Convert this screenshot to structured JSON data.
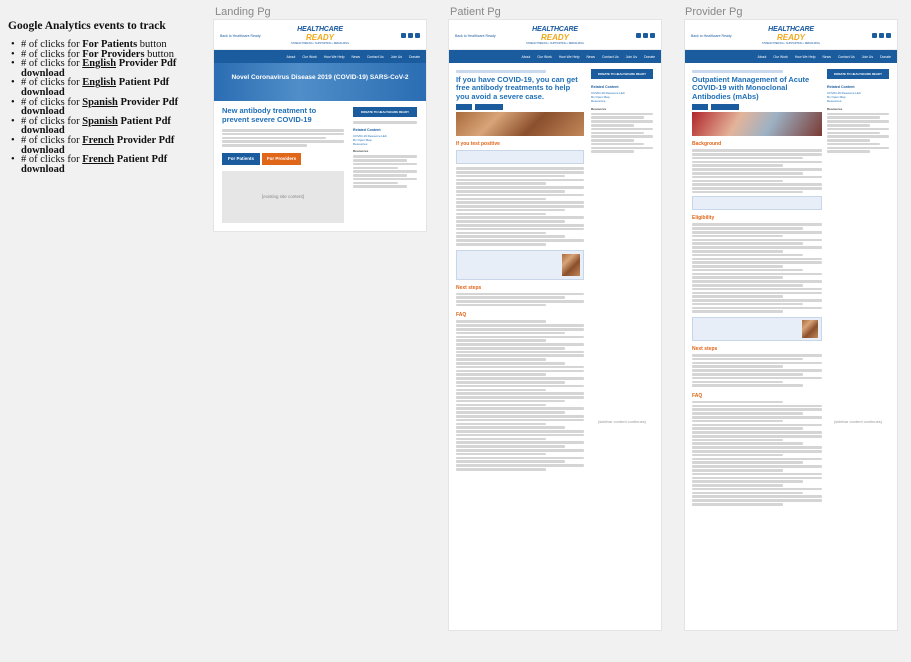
{
  "notes": {
    "title": "Google Analytics events to track",
    "items": [
      {
        "prefix": "# of clicks for ",
        "bold": "For Patients",
        "underline": "",
        "rest": " button"
      },
      {
        "prefix": "# of clicks for ",
        "bold": "For Providers",
        "underline": "",
        "rest": " button"
      },
      {
        "prefix": "# of clicks for ",
        "bold": "",
        "underline": "English",
        "rest": " Provider Pdf download"
      },
      {
        "prefix": "# of clicks for ",
        "bold": "",
        "underline": "English",
        "rest": " Patient Pdf download"
      },
      {
        "prefix": "# of clicks for ",
        "bold": "",
        "underline": "Spanish",
        "rest": " Provider Pdf download"
      },
      {
        "prefix": "# of clicks for ",
        "bold": "",
        "underline": "Spanish",
        "rest": " Patient Pdf download"
      },
      {
        "prefix": "# of clicks for ",
        "bold": "",
        "underline": "French",
        "rest": " Provider Pdf download"
      },
      {
        "prefix": "# of clicks for ",
        "bold": "",
        "underline": "French",
        "rest": " Patient Pdf download"
      }
    ]
  },
  "columns": {
    "landing": "Landing Pg",
    "patient": "Patient Pg",
    "provider": "Provider Pg"
  },
  "site": {
    "back_link": "Back to Healthcare Ready",
    "logo_top": "HEALTHCARE",
    "logo_bottom": "READY",
    "logo_tag": "STRENGTHENING • SUPPORTING • REBUILDING",
    "nav": [
      "About",
      "Our Work",
      "How We Help",
      "News",
      "Contact Us",
      "Join Us",
      "Donate"
    ],
    "donate": "DONATE TO HEALTHCARE READY",
    "related_title": "Related Content",
    "related": [
      "COVID-19 Resource Hub",
      "Rx Open Map",
      "Resources"
    ],
    "resources_title": "Resources"
  },
  "landing": {
    "hero": "Novel Coronavirus Disease 2019 (COVID-19) SARS-CoV-2",
    "headline": "New antibody treatment to prevent severe COVID-19",
    "btn_patients": "For Patients",
    "btn_providers": "For Providers",
    "existing": "[existing site content]"
  },
  "patient": {
    "headline": "If you have COVID-19, you can get free antibody treatments to help you avoid a severe case.",
    "section1": "If you test positive",
    "section2": "Next steps",
    "section3": "FAQ",
    "sidebar_cont": "(sidebar content continues)"
  },
  "provider": {
    "headline": "Outpatient Management of Acute COVID-19 with Monoclonal Antibodies (mAbs)",
    "section1": "Background",
    "section2": "Eligibility",
    "section3": "Next steps",
    "section4": "FAQ",
    "sidebar_cont": "(sidebar content continues)"
  },
  "colors": {
    "brand_blue": "#1b5c9e",
    "accent_orange": "#e0661a",
    "heading_blue": "#1e6fb8"
  }
}
